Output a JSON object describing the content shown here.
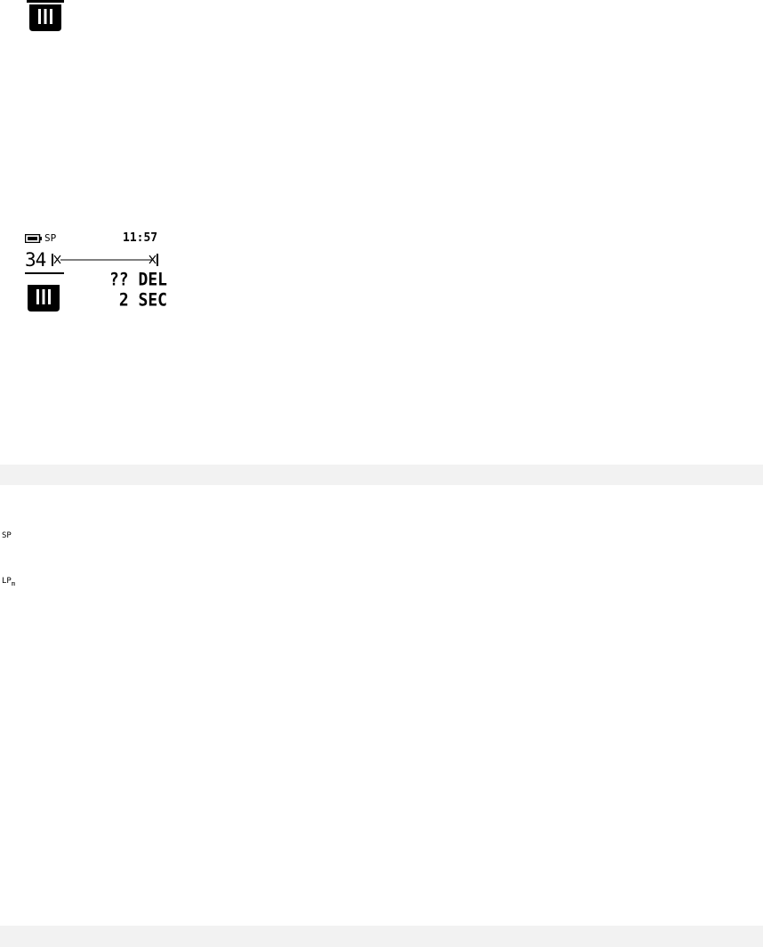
{
  "colors": {
    "ink": "#000000",
    "background": "#ffffff",
    "band": "#f2f2f2"
  },
  "top_icon": {
    "name": "trash-can-icon"
  },
  "lcd": {
    "battery_icon": "battery-full-icon",
    "mode": "SP",
    "time": "11:57",
    "track_number": "34",
    "delete_icon": "trash-can-icon",
    "prompt_line1": "?? DEL",
    "prompt_line2": "2 SEC"
  },
  "legend": {
    "mode_sp": "SP",
    "mode_lp": "LP",
    "mode_lp_sub": "m"
  }
}
